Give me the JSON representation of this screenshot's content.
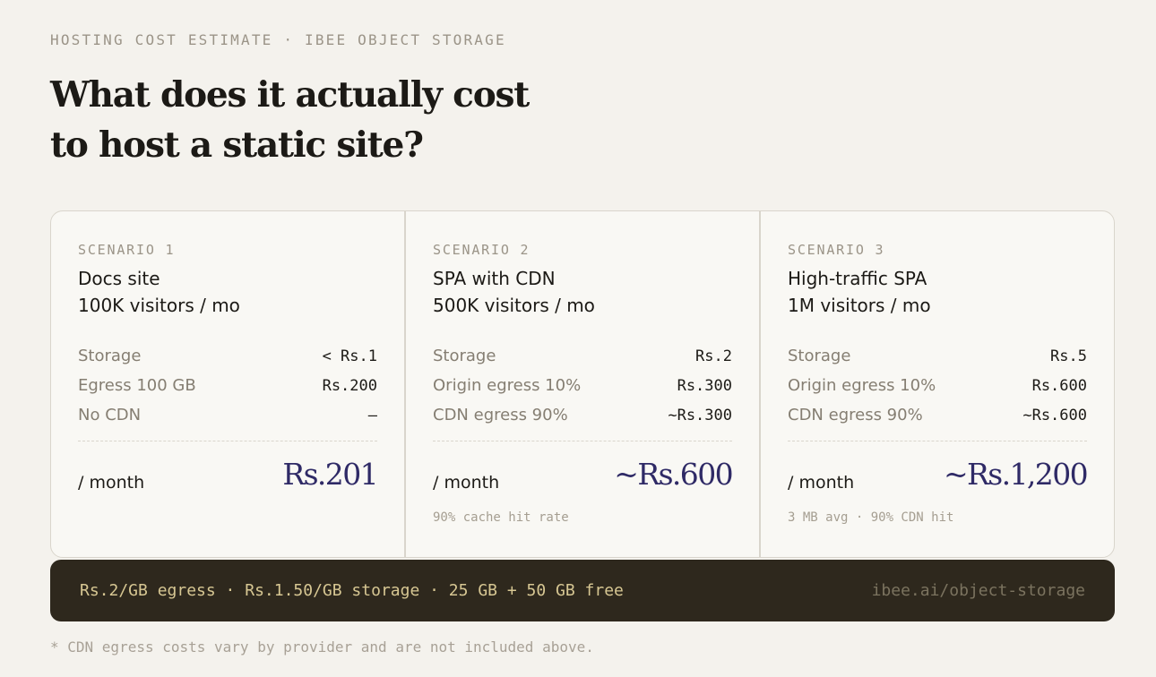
{
  "header": {
    "eyebrow": "HOSTING COST ESTIMATE · IBEE OBJECT STORAGE",
    "title_line1": "What does it actually cost",
    "title_line2": "to host a static site?"
  },
  "scenarios": [
    {
      "label": "SCENARIO 1",
      "name_line1": "Docs site",
      "name_line2": "100K visitors / mo",
      "rows": [
        {
          "label": "Storage",
          "value": "< Rs.1"
        },
        {
          "label": "Egress 100 GB",
          "value": "Rs.200"
        },
        {
          "label": "No CDN",
          "value": "—"
        }
      ],
      "period": "/ month",
      "total": "Rs.201",
      "note": ""
    },
    {
      "label": "SCENARIO 2",
      "name_line1": "SPA with CDN",
      "name_line2": "500K visitors / mo",
      "rows": [
        {
          "label": "Storage",
          "value": "Rs.2"
        },
        {
          "label": "Origin egress 10%",
          "value": "Rs.300"
        },
        {
          "label": "CDN egress 90%",
          "value": "~Rs.300"
        }
      ],
      "period": "/ month",
      "total": "~Rs.600",
      "note": "90% cache hit rate"
    },
    {
      "label": "SCENARIO 3",
      "name_line1": "High-traffic SPA",
      "name_line2": "1M visitors / mo",
      "rows": [
        {
          "label": "Storage",
          "value": "Rs.5"
        },
        {
          "label": "Origin egress 10%",
          "value": "Rs.600"
        },
        {
          "label": "CDN egress 90%",
          "value": "~Rs.600"
        }
      ],
      "period": "/ month",
      "total": "~Rs.1,200",
      "note": "3 MB avg · 90% CDN hit"
    }
  ],
  "pricing_bar": {
    "summary": "Rs.2/GB egress · Rs.1.50/GB storage · 25 GB + 50 GB free",
    "url": "ibee.ai/object-storage"
  },
  "footnote": "* CDN egress costs vary by provider and are not included above."
}
